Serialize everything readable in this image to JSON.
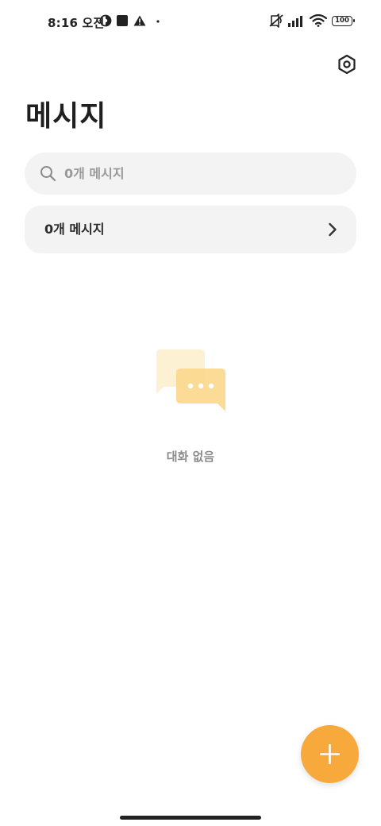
{
  "status_bar": {
    "time": "8:16 오전",
    "battery": "100",
    "icons": [
      "sync-icon",
      "app-notification-icon",
      "warning-icon",
      "more-dot-icon",
      "mute-icon",
      "signal-icon",
      "wifi-icon",
      "battery-icon"
    ]
  },
  "header": {
    "title": "메시지",
    "settings_icon": "gear-icon"
  },
  "search": {
    "placeholder": "0개 메시지",
    "value": "",
    "icon": "search-icon"
  },
  "message_row": {
    "label": "0개 메시지",
    "icon": "chevron-right-icon"
  },
  "empty_state": {
    "icon": "chat-bubbles-icon",
    "text": "대화 없음"
  },
  "fab": {
    "icon": "plus-icon"
  },
  "colors": {
    "accent": "#f7a93b",
    "background": "#ffffff",
    "surface": "#f3f3f3",
    "muted_text": "#8c8c8c"
  }
}
